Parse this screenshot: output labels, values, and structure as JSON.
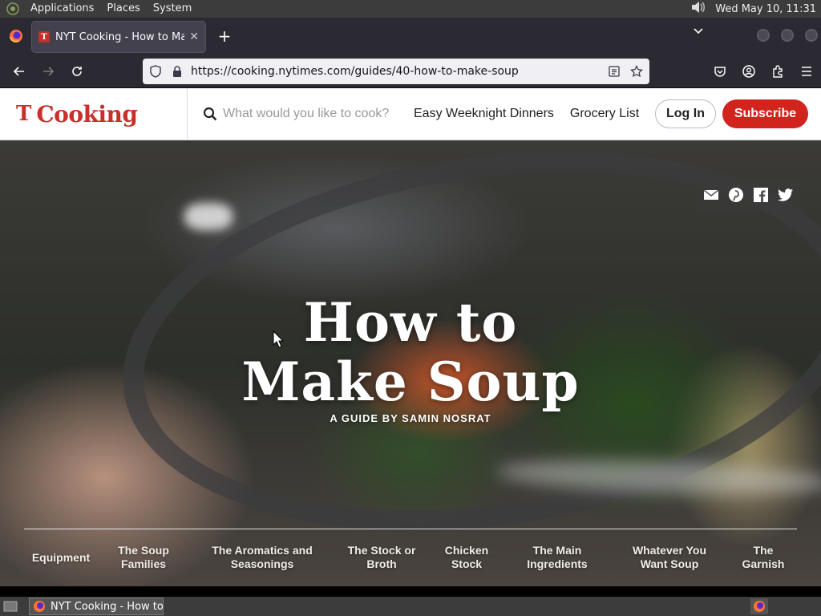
{
  "top_panel": {
    "menus": [
      "Applications",
      "Places",
      "System"
    ],
    "clock": "Wed May 10, 11:31"
  },
  "browser": {
    "tab_title": "NYT Cooking - How to Make Soup",
    "tab_favicon": "T",
    "url": "https://cooking.nytimes.com/guides/40-how-to-make-soup"
  },
  "site": {
    "brand_mark": "T",
    "brand_word": "Cooking",
    "search_placeholder": "What would you like to cook?",
    "links": [
      "Easy Weeknight Dinners",
      "Grocery List"
    ],
    "login_label": "Log In",
    "subscribe_label": "Subscribe",
    "brand_color": "#d0241d"
  },
  "hero": {
    "title_line1": "How to",
    "title_line2": "Make Soup",
    "subtitle": "A GUIDE BY SAMIN NOSRAT",
    "share_icons": [
      "email-icon",
      "pinterest-icon",
      "facebook-icon",
      "twitter-icon"
    ],
    "chapters": [
      {
        "label": "Equipment"
      },
      {
        "label": "The Soup Families"
      },
      {
        "label": "The Aromatics and Seasonings"
      },
      {
        "label": "The Stock or Broth"
      },
      {
        "label": "Chicken Stock"
      },
      {
        "label": "The Main Ingredients"
      },
      {
        "label": "Whatever You Want Soup"
      },
      {
        "label": "The Garnish"
      }
    ]
  },
  "taskbar": {
    "window_label": "NYT Cooking - How to Make Soup"
  }
}
